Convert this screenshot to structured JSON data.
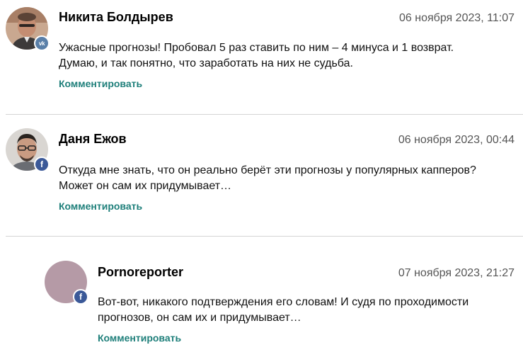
{
  "comments": [
    {
      "author": "Никита Болдырев",
      "date": "06 ноября 2023, 11:07",
      "text_line1": "Ужасные прогнозы! Пробовал 5 раз ставить по ним – 4 минуса и 1 возврат.",
      "text_line2": "Думаю, и так понятно, что заработать на них не судьба.",
      "reply_label": "Комментировать",
      "social": "vk",
      "social_icon": "vk-icon",
      "avatar_kind": "photo"
    },
    {
      "author": "Даня Ежов",
      "date": "06 ноября 2023, 00:44",
      "text_line1": "Откуда мне знать, что он реально берёт эти прогнозы у популярных капперов?",
      "text_line2": "Может он сам их придумывает…",
      "reply_label": "Комментировать",
      "social": "facebook",
      "social_icon": "facebook-icon",
      "avatar_kind": "photo"
    },
    {
      "author": "Pornoreporter",
      "date": "07 ноября 2023, 21:27",
      "text_line1": "Вот-вот, никакого подтверждения его словам! И судя по проходимости",
      "text_line2": "прогнозов, он сам их и придумывает…",
      "reply_label": "Комментировать",
      "social": "facebook",
      "social_icon": "facebook-icon",
      "avatar_kind": "placeholder",
      "is_reply": true
    }
  ],
  "badges": {
    "vk_glyph": "vk",
    "fb_glyph": "f"
  },
  "colors": {
    "link": "#1e7f7a",
    "date": "#555555",
    "divider": "#d4d4d4",
    "placeholder_avatar": "#b59aa6",
    "vk": "#5a7fa8",
    "facebook": "#3b5998"
  }
}
